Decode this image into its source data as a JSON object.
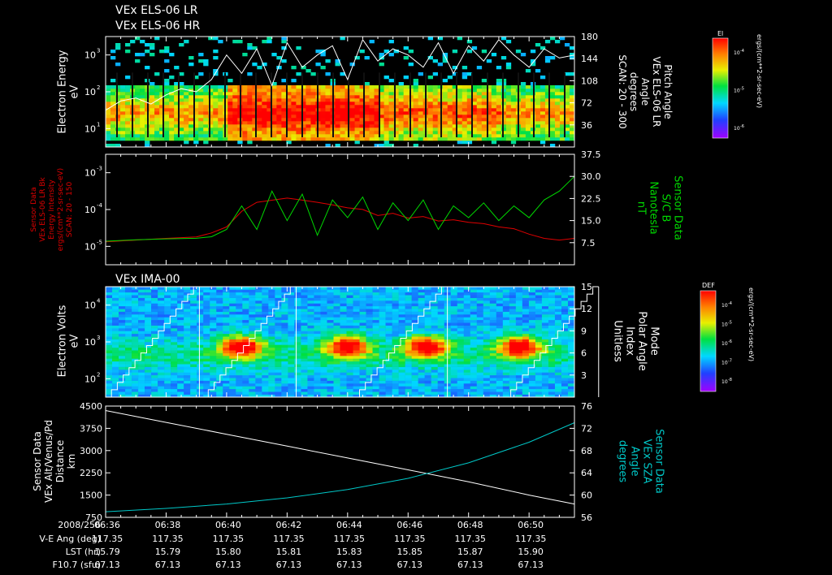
{
  "header": {
    "title_lr": "VEx ELS-06 LR",
    "title_hr": "VEx ELS-06 HR",
    "ima_title": "VEx IMA-00"
  },
  "colors": {
    "background": "#000000",
    "axis": "#ffffff",
    "mag_line": "#00d800",
    "energy_line": "#e00000",
    "sza_line": "#00c8c8",
    "cyan_label": "#00c8c8",
    "green_label": "#00d800",
    "red_label": "#e00000"
  },
  "panels": {
    "els": {
      "left_label": [
        "Electron Energy",
        "eV"
      ],
      "right_label": [
        "Pitch Angle",
        "VEx ELS-06 LR",
        "Angle",
        "degrees",
        "SCAN: 20 - 300"
      ],
      "left_ticks": [
        "10",
        "10",
        "10"
      ],
      "left_exps": [
        "1",
        "2",
        "3"
      ],
      "right_ticks": [
        "36",
        "72",
        "108",
        "144",
        "180"
      ],
      "colorbar": {
        "title": "El",
        "ticks": [
          "10",
          "10",
          "10"
        ],
        "exps": [
          "-4",
          "-5",
          "-6"
        ],
        "units": "ergs/(cm**2-sr-sec-eV)"
      }
    },
    "mag": {
      "left_label": [
        "Sensor Data",
        "VEx ELS-06 LR Bk",
        "Energy Intensity",
        "ergs/(cm**2-sr-sec-eV)",
        "SCAN: 20 - 150"
      ],
      "right_label": [
        "Sensor Data",
        "S/C B",
        "Nanotesla",
        "nT"
      ],
      "left_ticks": [
        "10",
        "10",
        "10"
      ],
      "left_exps": [
        "-5",
        "-4",
        "-3"
      ],
      "right_ticks": [
        "7.5",
        "15.0",
        "22.5",
        "30.0",
        "37.5"
      ]
    },
    "ima": {
      "left_label": [
        "Electron Volts",
        "eV"
      ],
      "right_label": [
        "Mode",
        "Polar Angle",
        "Index",
        "Unitless"
      ],
      "left_ticks": [
        "10",
        "10",
        "10"
      ],
      "left_exps": [
        "2",
        "3",
        "4"
      ],
      "right_ticks": [
        "3",
        "6",
        "9",
        "12",
        "15"
      ],
      "colorbar": {
        "title": "DEF",
        "ticks": [
          "10",
          "10",
          "10",
          "10"
        ],
        "exps": [
          "-4",
          "-5",
          "-6",
          "-7",
          "-8"
        ],
        "units": "ergs/(cm**2-sr-sec-eV)"
      }
    },
    "orbit": {
      "left_label": [
        "Sensor Data",
        "VEx Alt/Venus/Pd",
        "Distance",
        "km"
      ],
      "right_label": [
        "Sensor Data",
        "VEx SZA",
        "Angle",
        "degrees"
      ],
      "left_ticks": [
        "750",
        "1500",
        "2250",
        "3000",
        "3750",
        "4500"
      ],
      "right_ticks": [
        "56",
        "60",
        "64",
        "68",
        "72",
        "76"
      ]
    }
  },
  "time_axis": {
    "row_labels": [
      "2008/256",
      "V-E Ang (deg)",
      "LST (hr)",
      "F10.7 (sfu)"
    ],
    "times": [
      "06:36",
      "06:38",
      "06:40",
      "06:42",
      "06:44",
      "06:46",
      "06:48",
      "06:50"
    ],
    "ve_ang": [
      "117.35",
      "117.35",
      "117.35",
      "117.35",
      "117.35",
      "117.35",
      "117.35",
      "117.35"
    ],
    "lst": [
      "15.79",
      "15.79",
      "15.80",
      "15.81",
      "15.83",
      "15.85",
      "15.87",
      "15.90"
    ],
    "f107": [
      "67.13",
      "67.13",
      "67.13",
      "67.13",
      "67.13",
      "67.13",
      "67.13",
      "67.13"
    ]
  },
  "chart_data": [
    {
      "type": "heatmap",
      "panel": "els",
      "x": [
        "06:36",
        "06:38",
        "06:40",
        "06:42",
        "06:44",
        "06:46",
        "06:48",
        "06:50"
      ],
      "ylabel": "Electron Energy eV",
      "ylim": [
        3,
        1000
      ],
      "yscale": "log",
      "zlabel": "El ergs/(cm**2-sr-sec-eV)",
      "zlim": [
        1e-06,
        0.0001
      ],
      "peak_energy_band_eV": [
        8,
        60
      ],
      "strongest_interval": [
        "06:40",
        "06:45"
      ]
    },
    {
      "type": "line",
      "panel": "els_pitch_overlay",
      "ylabel": "Pitch Angle degrees",
      "ylim": [
        0,
        180
      ],
      "x_minutes": [
        0,
        0.5,
        1,
        1.5,
        2,
        2.5,
        3,
        3.5,
        4,
        4.5,
        5,
        5.5,
        6,
        6.5,
        7,
        7.5,
        8,
        8.5,
        9,
        9.5,
        10,
        10.5,
        11,
        11.5,
        12,
        12.5,
        13,
        13.5,
        14,
        14.5,
        15,
        15.5
      ],
      "values": [
        60,
        75,
        80,
        70,
        85,
        95,
        90,
        110,
        150,
        120,
        160,
        100,
        170,
        130,
        150,
        165,
        110,
        175,
        140,
        160,
        150,
        130,
        170,
        120,
        165,
        140,
        175,
        150,
        130,
        160,
        145,
        150
      ]
    },
    {
      "type": "line",
      "panel": "mag",
      "x": [
        "06:36",
        "06:38",
        "06:40",
        "06:42",
        "06:44",
        "06:46",
        "06:48",
        "06:50"
      ],
      "series": [
        {
          "name": "Energy Intensity",
          "yscale": "log",
          "ylim": [
            3e-06,
            0.001
          ],
          "x_minutes": [
            0,
            1,
            2,
            3,
            3.5,
            4,
            4.5,
            5,
            6,
            6.5,
            7,
            7.5,
            8,
            8.5,
            9,
            9.5,
            10,
            10.5,
            11,
            11.5,
            12,
            12.5,
            13,
            13.5,
            14,
            14.5,
            15,
            15.5
          ],
          "values": [
            1e-05,
            1.1e-05,
            1.2e-05,
            1.3e-05,
            1.6e-05,
            2.2e-05,
            5e-05,
            8e-05,
            0.0001,
            9e-05,
            8e-05,
            7e-05,
            6e-05,
            5.5e-05,
            4e-05,
            4.5e-05,
            3.5e-05,
            3.8e-05,
            3e-05,
            3.2e-05,
            2.8e-05,
            2.6e-05,
            2.2e-05,
            2e-05,
            1.5e-05,
            1.2e-05,
            1.1e-05,
            1.2e-05
          ]
        },
        {
          "name": "S/C B",
          "units": "nT",
          "ylim": [
            0,
            37.5
          ],
          "x_minutes": [
            0,
            1,
            2,
            3,
            3.5,
            4,
            4.5,
            5,
            5.5,
            6,
            6.5,
            7,
            7.5,
            8,
            8.5,
            9,
            9.5,
            10,
            10.5,
            11,
            11.5,
            12,
            12.5,
            13,
            13.5,
            14,
            14.5,
            15,
            15.5
          ],
          "values": [
            8.0,
            8.5,
            8.8,
            9.0,
            9.5,
            12.0,
            20.0,
            12.0,
            25.0,
            15.0,
            24.0,
            10.0,
            22.0,
            16.0,
            23.0,
            12.0,
            21.0,
            15.0,
            22.0,
            12.0,
            20.0,
            16.0,
            21.0,
            15.0,
            20.0,
            16.0,
            22.0,
            25.0,
            30.0
          ]
        }
      ]
    },
    {
      "type": "heatmap",
      "panel": "ima",
      "x": [
        "06:36",
        "06:38",
        "06:40",
        "06:42",
        "06:44",
        "06:46",
        "06:48",
        "06:50"
      ],
      "ylabel": "Electron Volts eV",
      "ylim": [
        10,
        50000
      ],
      "yscale": "log",
      "zlabel": "DEF",
      "zlim": [
        1e-08,
        0.0001
      ],
      "polar_angle_index": {
        "ylim": [
          0,
          15
        ],
        "sweep_starts_minutes": [
          0,
          3.2,
          8.2,
          13.2
        ],
        "sweep_duration_minutes": 3.1
      }
    },
    {
      "type": "line",
      "panel": "orbit",
      "x": [
        "06:36",
        "06:38",
        "06:40",
        "06:42",
        "06:44",
        "06:46",
        "06:48",
        "06:50"
      ],
      "series": [
        {
          "name": "Alt/Venus/Pd",
          "units": "km",
          "ylim": [
            750,
            4500
          ],
          "x_minutes": [
            0,
            2,
            4,
            6,
            8,
            10,
            12,
            14,
            15.5
          ],
          "values": [
            4350,
            3950,
            3550,
            3150,
            2750,
            2350,
            1950,
            1500,
            1200
          ]
        },
        {
          "name": "SZA",
          "units": "degrees",
          "ylim": [
            56,
            76
          ],
          "x_minutes": [
            0,
            2,
            4,
            6,
            8,
            10,
            12,
            14,
            15.5
          ],
          "values": [
            57.0,
            57.6,
            58.4,
            59.5,
            61.0,
            63.0,
            65.8,
            69.5,
            73.0
          ]
        }
      ]
    }
  ]
}
